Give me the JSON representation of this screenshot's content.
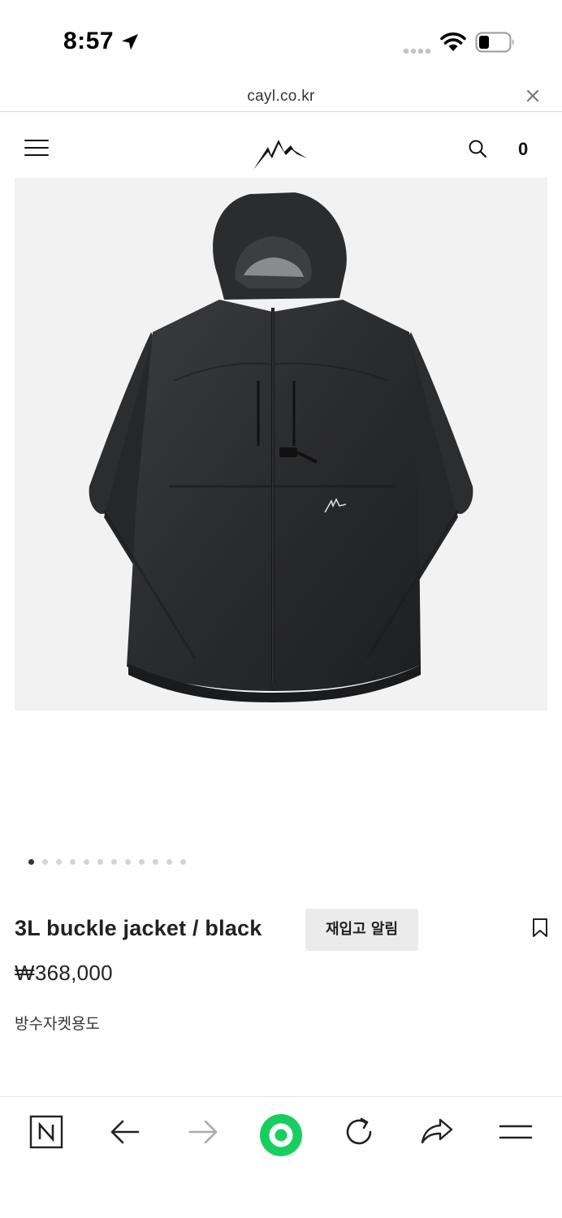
{
  "status_bar": {
    "time": "8:57",
    "icons": [
      "location-arrow-icon",
      "signal-icon",
      "wifi-icon",
      "battery-icon"
    ]
  },
  "url_bar": {
    "url": "cayl.co.kr",
    "close_icon": "close-icon"
  },
  "header": {
    "menu_icon": "hamburger-menu-icon",
    "logo_icon": "mountain-logo-icon",
    "search_icon": "search-icon",
    "cart_count": "0"
  },
  "product": {
    "image": "black-shell-jacket-image",
    "carousel": {
      "total": 12,
      "active_index": 0
    },
    "title": "3L buckle jacket / black",
    "restock_label": "재입고 알림",
    "price": "₩368,000",
    "description": "방수자켓용도",
    "bookmark_icon": "bookmark-icon"
  },
  "browser_toolbar": {
    "items": [
      "naver-home-icon",
      "back-arrow-icon",
      "forward-arrow-icon",
      "green-assistant-icon",
      "reload-icon",
      "share-icon",
      "menu-lines-icon"
    ],
    "accent_color": "#19ce60"
  }
}
